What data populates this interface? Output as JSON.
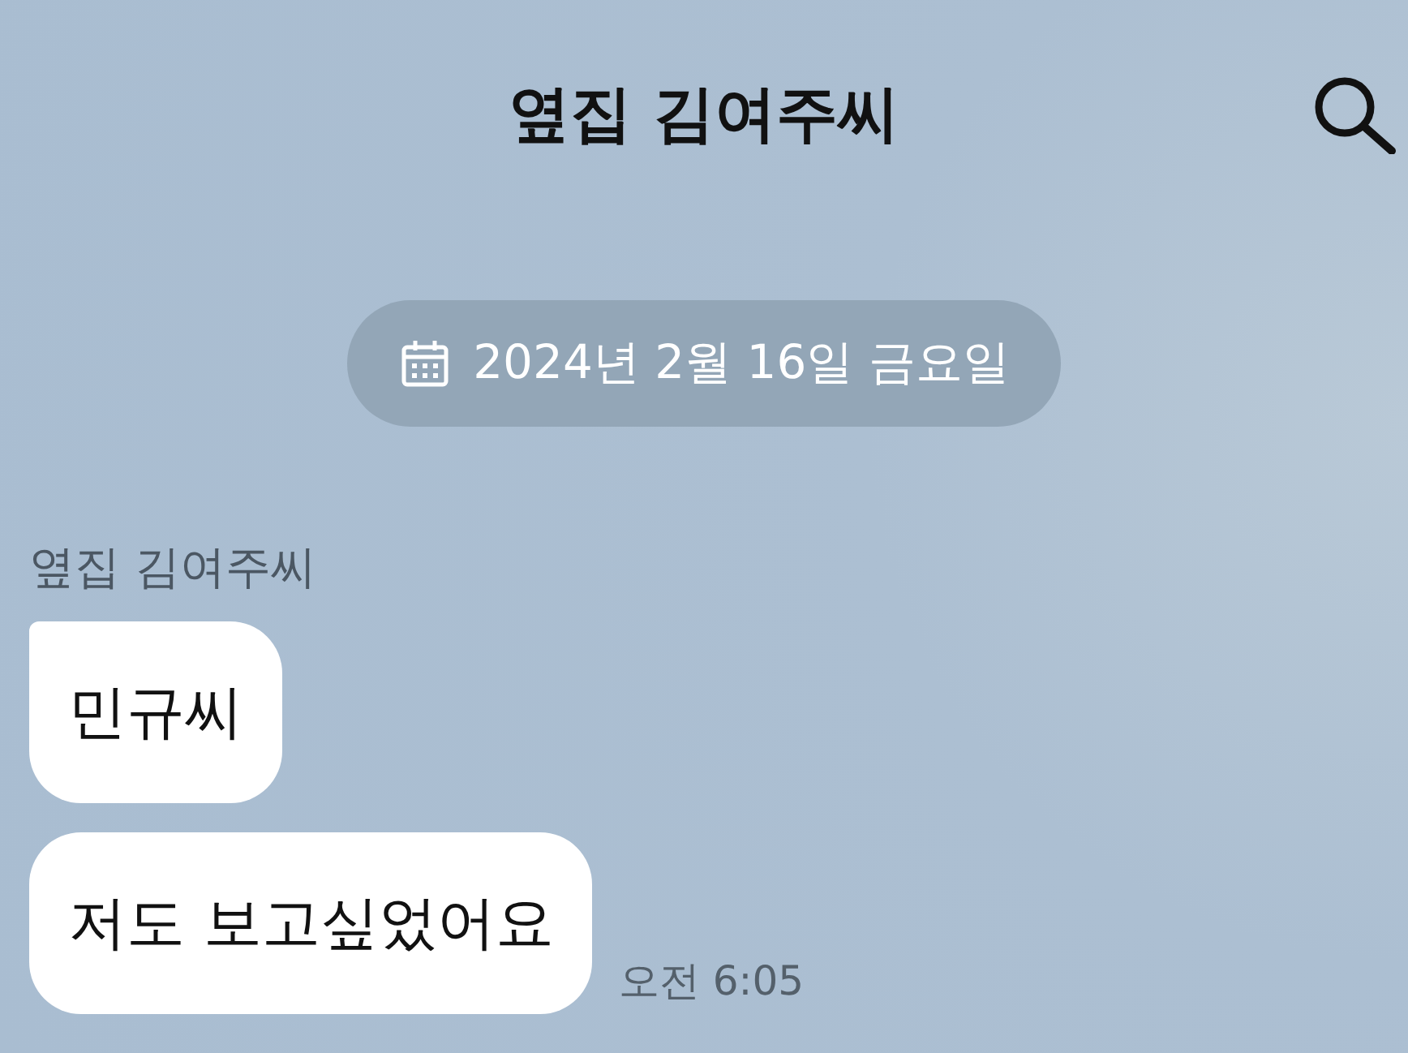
{
  "header": {
    "title": "옆집 김여주씨"
  },
  "date_divider": {
    "text": "2024년 2월 16일 금요일"
  },
  "messages": [
    {
      "sender": "옆집 김여주씨",
      "time": "오전 6:05",
      "bubbles": [
        {
          "text": "민규씨",
          "tail": true
        },
        {
          "text": "저도 보고싶었어요",
          "tail": false
        }
      ]
    }
  ]
}
